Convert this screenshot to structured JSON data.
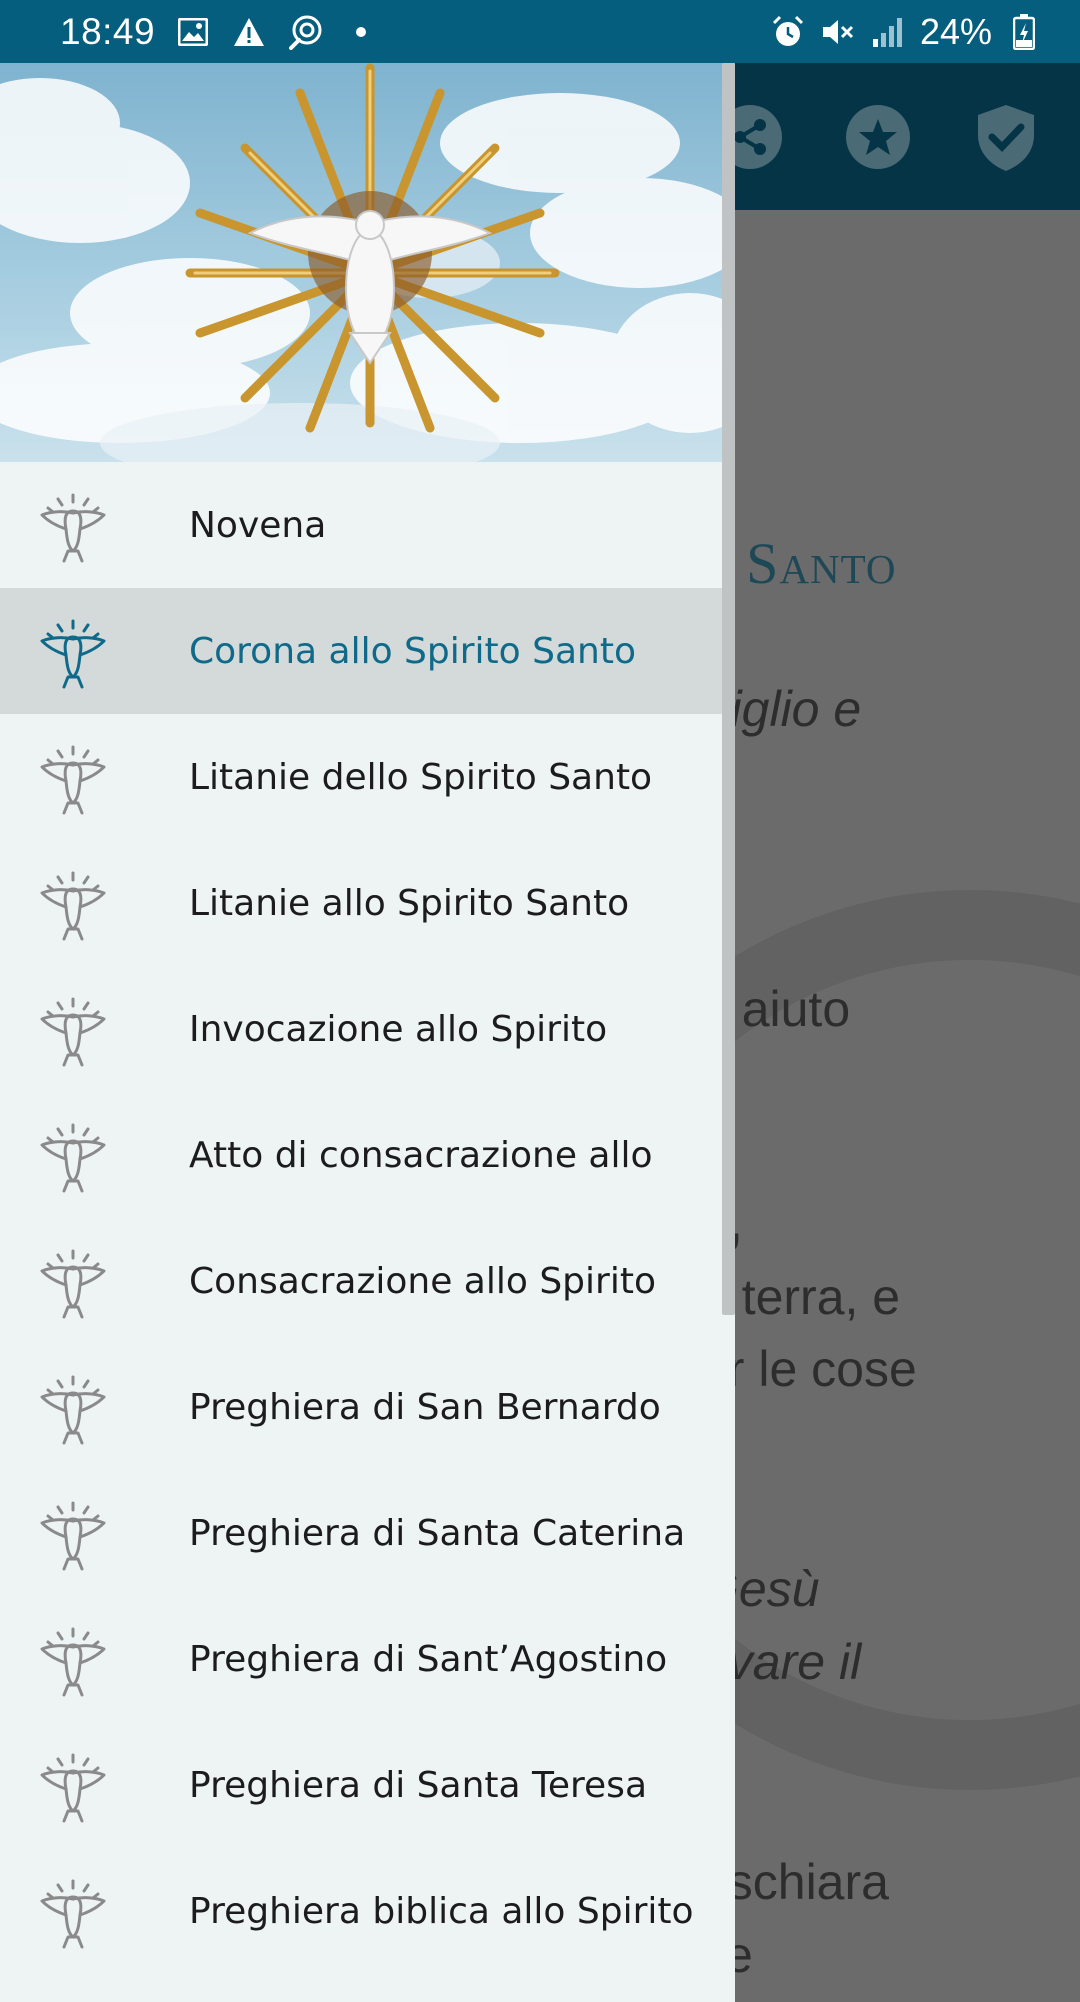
{
  "status_bar": {
    "time": "18:49",
    "battery": "24%",
    "icons": [
      "image-icon",
      "warning-icon",
      "cast-icon",
      "dot-icon",
      "alarm-icon",
      "mute-icon",
      "signal-icon",
      "battery-icon"
    ]
  },
  "app_bar": {
    "actions": [
      "share-icon",
      "star-icon",
      "shield-check-icon"
    ]
  },
  "content": {
    "title_fragment": "o Santo",
    "lines": [
      {
        "text": "Figlio e",
        "style": "italic"
      },
      {
        "text": "o aiuto",
        "style": "normal"
      },
      {
        "text": "a,",
        "style": "bold"
      },
      {
        "text": "a terra, e",
        "style": "normal"
      },
      {
        "text": "er le cose",
        "style": "normal"
      },
      {
        "text": "Gesù",
        "style": "italic"
      },
      {
        "text": "ovare il",
        "style": "italic"
      },
      {
        "text": "rischiara",
        "style": "normal"
      },
      {
        "text": "ce",
        "style": "normal"
      }
    ]
  },
  "drawer": {
    "menu": [
      {
        "label": "Novena",
        "active": false
      },
      {
        "label": "Corona allo Spirito Santo",
        "active": true
      },
      {
        "label": "Litanie dello Spirito Santo",
        "active": false
      },
      {
        "label": "Litanie allo Spirito Santo",
        "active": false
      },
      {
        "label": "Invocazione allo Spirito",
        "active": false
      },
      {
        "label": "Atto di consacrazione allo",
        "active": false
      },
      {
        "label": "Consacrazione allo Spirito",
        "active": false
      },
      {
        "label": "Preghiera di San Bernardo",
        "active": false
      },
      {
        "label": "Preghiera di Santa Caterina",
        "active": false
      },
      {
        "label": "Preghiera di Sant’Agostino",
        "active": false
      },
      {
        "label": "Preghiera di Santa Teresa",
        "active": false
      },
      {
        "label": "Preghiera biblica allo Spirito",
        "active": false
      }
    ]
  },
  "colors": {
    "status_bar": "#055e7d",
    "app_bar": "#043446",
    "drawer_bg": "#eef4f4",
    "active_bg": "#d4d9d9",
    "active_text": "#0f6a8a",
    "text": "#1c1c1c",
    "icon_gray": "#8a8a8a"
  }
}
